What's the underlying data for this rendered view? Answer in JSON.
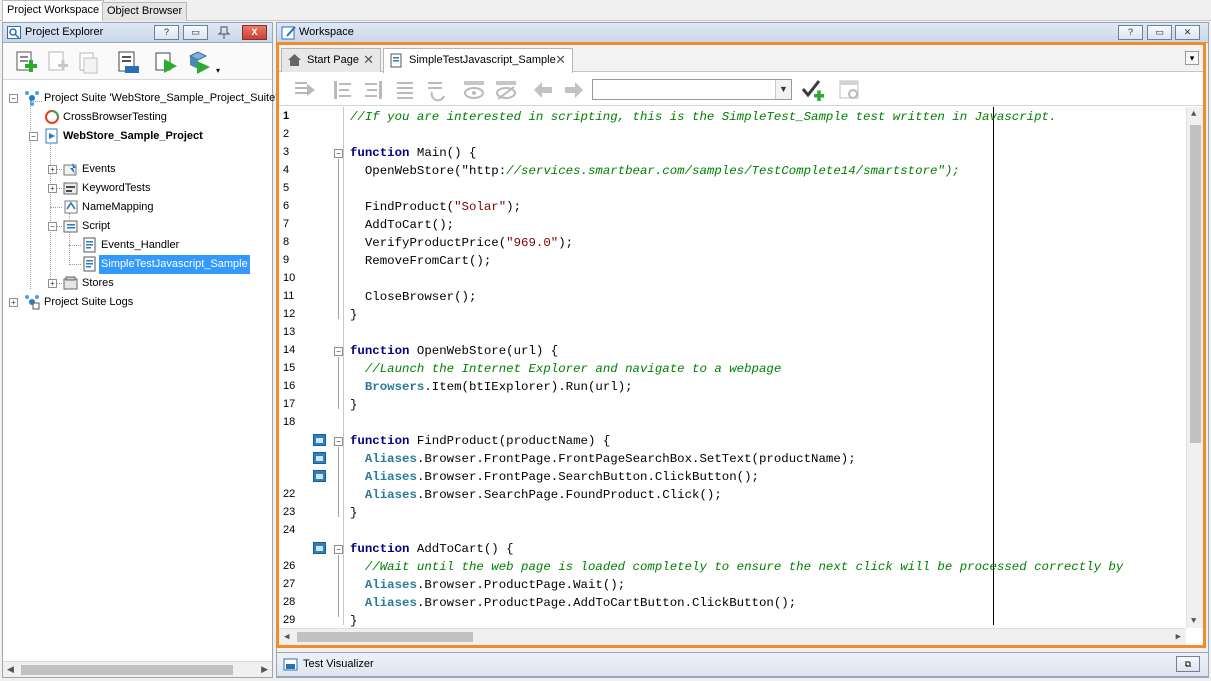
{
  "top_tabs": [
    "Project Workspace",
    "Object Browser"
  ],
  "project_explorer": {
    "title": "Project Explorer",
    "header_buttons": [
      "?",
      "▭"
    ],
    "close_label": "X",
    "tree": [
      {
        "label": "Project Suite 'WebStore_Sample_Project_Suite'",
        "icon": "suite-icon"
      },
      {
        "label": "CrossBrowserTesting",
        "icon": "cross-browser-icon"
      },
      {
        "label": "WebStore_Sample_Project",
        "icon": "project-icon"
      },
      {
        "label": "Events",
        "icon": "events-icon"
      },
      {
        "label": "KeywordTests",
        "icon": "keyword-tests-icon"
      },
      {
        "label": "NameMapping",
        "icon": "name-mapping-icon"
      },
      {
        "label": "Script",
        "icon": "script-folder-icon"
      },
      {
        "label": "Events_Handler",
        "icon": "script-file-icon"
      },
      {
        "label": "SimpleTestJavascript_Sample",
        "icon": "script-file-icon"
      },
      {
        "label": "Stores",
        "icon": "stores-icon"
      },
      {
        "label": "Project Suite Logs",
        "icon": "logs-icon"
      }
    ]
  },
  "workspace": {
    "title": "Workspace",
    "header_buttons": [
      "?",
      "▭",
      "✕"
    ],
    "tabs": [
      {
        "label": "Start Page",
        "icon": "home-icon"
      },
      {
        "label": "SimpleTestJavascript_Sample",
        "icon": "script-file-icon"
      }
    ],
    "code_lines": [
      {
        "n": "1",
        "text": "//If you are interested in scripting, this is the SimpleTest_Sample test written in Javascript."
      },
      {
        "n": "2",
        "text": ""
      },
      {
        "n": "3",
        "text": "function Main() {"
      },
      {
        "n": "4",
        "text": "  OpenWebStore(\"http://services.smartbear.com/samples/TestComplete14/smartstore\");"
      },
      {
        "n": "5",
        "text": ""
      },
      {
        "n": "6",
        "text": "  FindProduct(\"Solar\");"
      },
      {
        "n": "7",
        "text": "  AddToCart();"
      },
      {
        "n": "8",
        "text": "  VerifyProductPrice(\"969.0\");"
      },
      {
        "n": "9",
        "text": "  RemoveFromCart();"
      },
      {
        "n": "10",
        "text": ""
      },
      {
        "n": "11",
        "text": "  CloseBrowser();"
      },
      {
        "n": "12",
        "text": "}"
      },
      {
        "n": "13",
        "text": ""
      },
      {
        "n": "14",
        "text": "function OpenWebStore(url) {"
      },
      {
        "n": "15",
        "text": "  //Launch the Internet Explorer and navigate to a webpage"
      },
      {
        "n": "16",
        "text": "  Browsers.Item(btIExplorer).Run(url);"
      },
      {
        "n": "17",
        "text": "}"
      },
      {
        "n": "18",
        "text": ""
      },
      {
        "n": "",
        "text": "function FindProduct(productName) {"
      },
      {
        "n": "",
        "text": "  Aliases.Browser.FrontPage.FrontPageSearchBox.SetText(productName);"
      },
      {
        "n": "",
        "text": "  Aliases.Browser.FrontPage.SearchButton.ClickButton();"
      },
      {
        "n": "22",
        "text": "  Aliases.Browser.SearchPage.FoundProduct.Click();"
      },
      {
        "n": "23",
        "text": "}"
      },
      {
        "n": "24",
        "text": ""
      },
      {
        "n": "",
        "text": "function AddToCart() {"
      },
      {
        "n": "26",
        "text": "  //Wait until the web page is loaded completely to ensure the next click will be processed correctly by"
      },
      {
        "n": "27",
        "text": "  Aliases.Browser.ProductPage.Wait();"
      },
      {
        "n": "28",
        "text": "  Aliases.Browser.ProductPage.AddToCartButton.ClickButton();"
      },
      {
        "n": "29",
        "text": "}"
      }
    ]
  },
  "bottom_panel": {
    "label": "Test Visualizer"
  },
  "colors": {
    "highlight_frame": "#f28c28",
    "selection": "#3399ff",
    "keyword": "#000080",
    "comment": "#008000",
    "string": "#800000",
    "object": "#2b7a9b"
  }
}
